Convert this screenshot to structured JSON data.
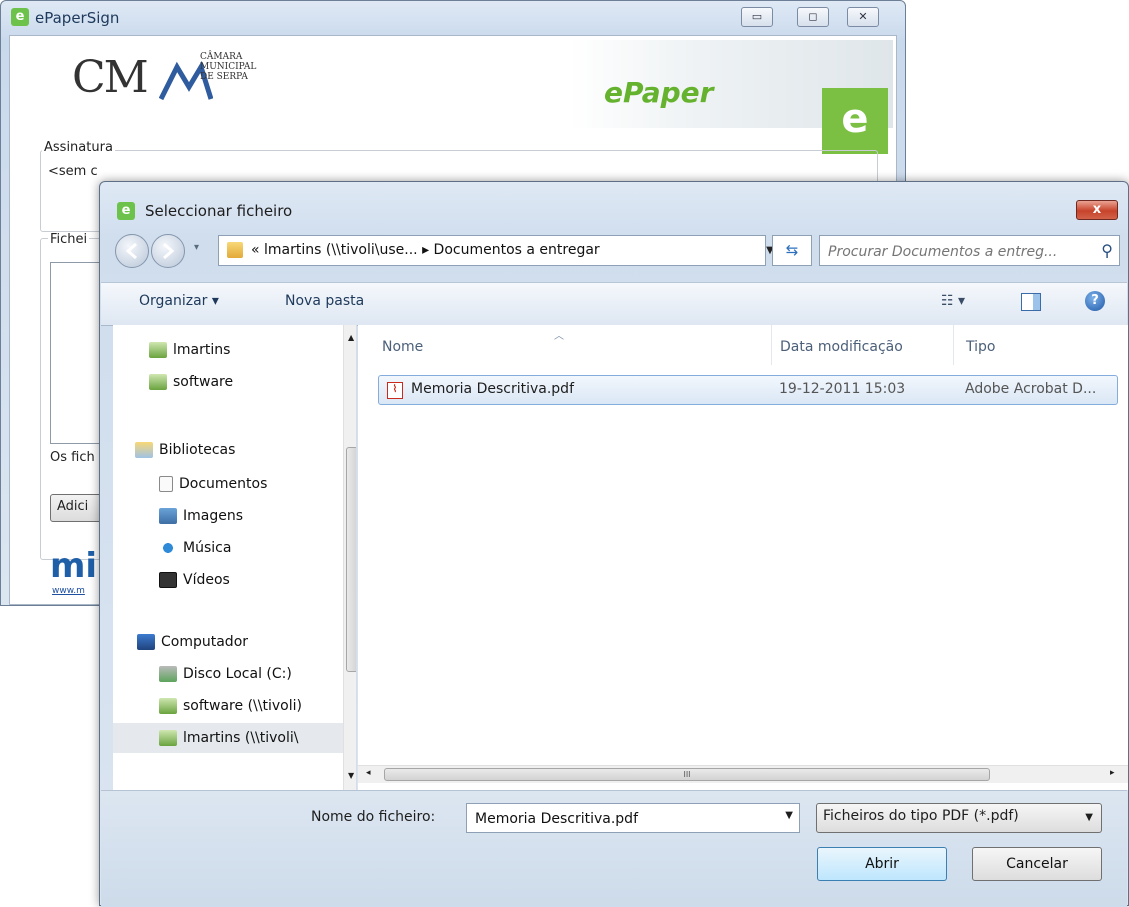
{
  "main_window": {
    "title": "ePaperSign",
    "logo_cm": "CM",
    "logo_lines": [
      "CÂMARA",
      "MUNICIPAL",
      "DE SERPA"
    ],
    "brand": "ePaper",
    "brand_e": "e",
    "group_assinatura": "Assinatura",
    "sem_certificado": "<sem c",
    "ficheiros_label": "Fichei",
    "os_ficheiros": "Os fich",
    "adicionar_button": "Adici",
    "footer_logo": "mi",
    "footer_link": "www.m"
  },
  "dialog": {
    "title": "Seleccionar ficheiro",
    "close": "x",
    "address_path": "« lmartins (\\\\tivoli\\use... ▸ Documentos a entregar",
    "search_placeholder": "Procurar Documentos a entreg...",
    "toolbar": {
      "organizar": "Organizar ▾",
      "nova_pasta": "Nova pasta",
      "views": "☷ ▾",
      "help": "?"
    },
    "nav_items": [
      {
        "label": "lmartins",
        "icon": "network-drive-icon"
      },
      {
        "label": "software",
        "icon": "network-drive-icon"
      },
      {
        "label": "Bibliotecas",
        "icon": "library-icon"
      },
      {
        "label": "Documentos",
        "icon": "documents-icon"
      },
      {
        "label": "Imagens",
        "icon": "pictures-icon"
      },
      {
        "label": "Música",
        "icon": "music-icon"
      },
      {
        "label": "Vídeos",
        "icon": "videos-icon"
      },
      {
        "label": "Computador",
        "icon": "computer-icon"
      },
      {
        "label": "Disco Local (C:)",
        "icon": "local-disk-icon"
      },
      {
        "label": "software (\\\\tivoli)",
        "icon": "network-drive-icon"
      },
      {
        "label": "lmartins (\\\\tivoli\\",
        "icon": "network-drive-icon"
      }
    ],
    "columns": {
      "name": "Nome",
      "date": "Data modificação",
      "type": "Tipo"
    },
    "files": [
      {
        "name": "Memoria Descritiva.pdf",
        "date": "19-12-2011 15:03",
        "type": "Adobe Acrobat D..."
      }
    ],
    "hscroll_grip": "III",
    "filename_label": "Nome do ficheiro:",
    "filename_value": "Memoria Descritiva.pdf",
    "filetype": "Ficheiros do tipo PDF (*.pdf)",
    "open_button": "Abrir",
    "cancel_button": "Cancelar"
  }
}
